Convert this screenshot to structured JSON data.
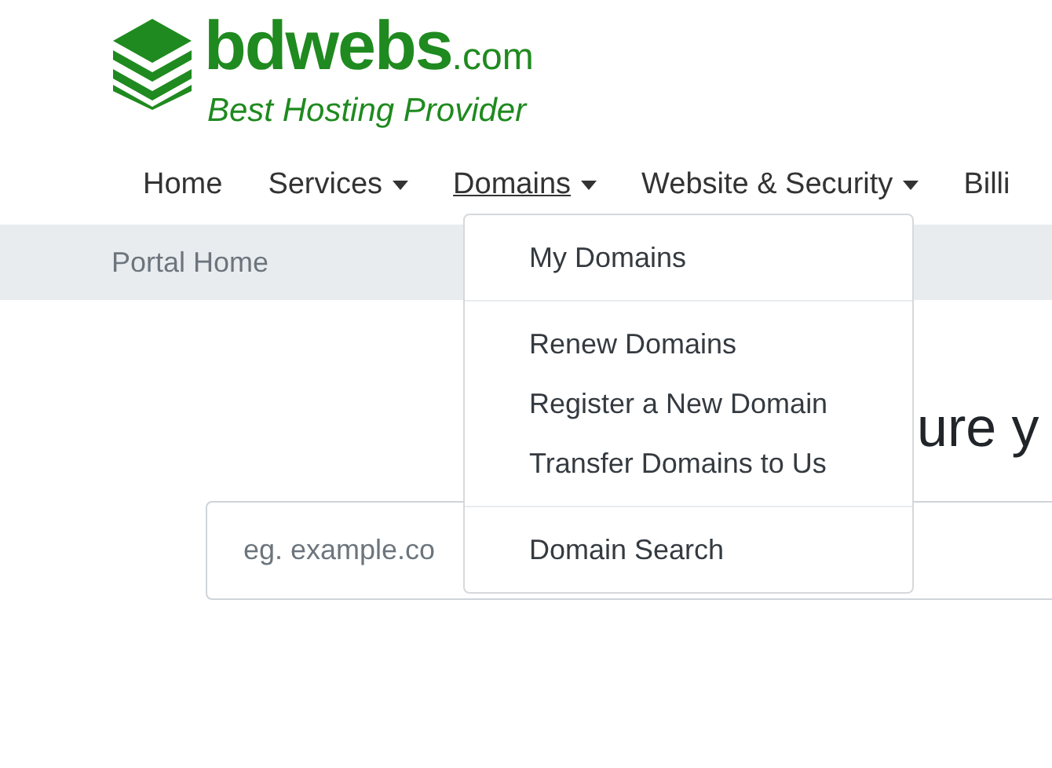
{
  "logo": {
    "name": "bdwebs",
    "suffix": ".com",
    "tagline": "Best Hosting Provider"
  },
  "nav": [
    {
      "label": "Home",
      "dropdown": false,
      "expanded": false
    },
    {
      "label": "Services",
      "dropdown": true,
      "expanded": false
    },
    {
      "label": "Domains",
      "dropdown": true,
      "expanded": true
    },
    {
      "label": "Website & Security",
      "dropdown": true,
      "expanded": false
    },
    {
      "label": "Billi",
      "dropdown": false,
      "expanded": false
    }
  ],
  "breadcrumb": "Portal Home",
  "domain_menu": [
    [
      {
        "label": "My Domains"
      }
    ],
    [
      {
        "label": "Renew Domains"
      },
      {
        "label": "Register a New Domain"
      },
      {
        "label": "Transfer Domains to Us"
      }
    ],
    [
      {
        "label": "Domain Search"
      }
    ]
  ],
  "headline": "ure y",
  "search": {
    "placeholder": "eg. example.co"
  }
}
